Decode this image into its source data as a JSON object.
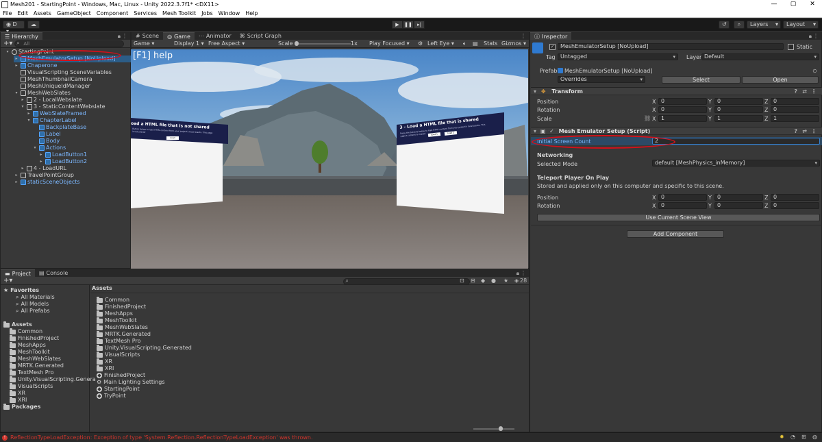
{
  "window": {
    "title": "Mesh201 - StartingPoint - Windows, Mac, Linux - Unity 2022.3.7f1* <DX11>",
    "controls": [
      "—",
      "▢",
      "✕"
    ]
  },
  "menu": [
    "File",
    "Edit",
    "Assets",
    "GameObject",
    "Component",
    "Services",
    "Mesh Toolkit",
    "Jobs",
    "Window",
    "Help"
  ],
  "toolbar": {
    "account": "D",
    "layers": "Layers",
    "layout": "Layout"
  },
  "hierarchy": {
    "tab": "Hierarchy",
    "search_placeholder": "All",
    "items": [
      {
        "label": "StartingPoint",
        "indent": 0,
        "fold": "▾",
        "type": "scene"
      },
      {
        "label": "MeshEmulatorSetup [NoUpload]",
        "indent": 1,
        "fold": "▸",
        "type": "prefab"
      },
      {
        "label": "Chaperone",
        "indent": 1,
        "fold": "▸",
        "type": "prefab"
      },
      {
        "label": "VisualScripting SceneVariables",
        "indent": 1,
        "fold": "",
        "type": "object"
      },
      {
        "label": "MeshThumbnailCamera",
        "indent": 1,
        "fold": "",
        "type": "object"
      },
      {
        "label": "MeshUniqueIdManager",
        "indent": 1,
        "fold": "",
        "type": "object"
      },
      {
        "label": "MeshWebSlates",
        "indent": 1,
        "fold": "▾",
        "type": "object"
      },
      {
        "label": "2 - LocalWebslate",
        "indent": 2,
        "fold": "▸",
        "type": "object"
      },
      {
        "label": "3 - StaticContentWebslate",
        "indent": 2,
        "fold": "▾",
        "type": "object"
      },
      {
        "label": "WebSlateFramed",
        "indent": 3,
        "fold": "▸",
        "type": "prefab"
      },
      {
        "label": "ChapterLabel",
        "indent": 3,
        "fold": "▾",
        "type": "prefab"
      },
      {
        "label": "BackplateBase",
        "indent": 4,
        "fold": "",
        "type": "prefab"
      },
      {
        "label": "Label",
        "indent": 4,
        "fold": "",
        "type": "prefab"
      },
      {
        "label": "Body",
        "indent": 4,
        "fold": "",
        "type": "prefab"
      },
      {
        "label": "Actions",
        "indent": 4,
        "fold": "▾",
        "type": "prefab"
      },
      {
        "label": "LoadButton1",
        "indent": 5,
        "fold": "▸",
        "type": "prefab"
      },
      {
        "label": "LoadButton2",
        "indent": 5,
        "fold": "▸",
        "type": "prefab"
      },
      {
        "label": "4 - LoadURL",
        "indent": 2,
        "fold": "▸",
        "type": "object"
      },
      {
        "label": "TravelPointGroup",
        "indent": 1,
        "fold": "▸",
        "type": "object"
      },
      {
        "label": "staticSceneObjects",
        "indent": 1,
        "fold": "▸",
        "type": "prefab"
      }
    ]
  },
  "scene_tabs": [
    "Scene",
    "Game",
    "Animator",
    "Script Graph"
  ],
  "game_bar": {
    "mode": "Game",
    "display": "Display 1",
    "aspect": "Free Aspect",
    "scale_label": "Scale",
    "scale_value": "1x",
    "play_focused": "Play Focused",
    "eye": "Left Eye",
    "stats": "Stats",
    "gizmos": "Gizmos"
  },
  "game": {
    "help": "[F1] help",
    "left_slate_title": "oad a HTML file that is not shared",
    "left_slate_body": "Button below to load HTML content from your project's local assets. This page is not shared",
    "left_slate_button": "Load",
    "right_slate_title": "3 - Load a HTML file that is shared",
    "right_slate_body": "Press the buttons below to load HTML content from your project's local assets. This page's content is shared",
    "right_slate_buttons": [
      "Load 1",
      "Load 2"
    ]
  },
  "inspector": {
    "tab": "Inspector",
    "object_name": "MeshEmulatorSetup [NoUpload]",
    "static_label": "Static",
    "tag_label": "Tag",
    "tag_value": "Untagged",
    "layer_label": "Layer",
    "layer_value": "Default",
    "prefab_label": "Prefab",
    "prefab_value": "MeshEmulatorSetup [NoUpload]",
    "overrides": "Overrides",
    "select": "Select",
    "open": "Open",
    "transform": {
      "title": "Transform",
      "position_label": "Position",
      "rotation_label": "Rotation",
      "scale_label": "Scale",
      "position": [
        "0",
        "0",
        "0"
      ],
      "rotation": [
        "0",
        "0",
        "0"
      ],
      "scale": [
        "1",
        "1",
        "1"
      ]
    },
    "script": {
      "title": "Mesh Emulator Setup (Script)",
      "initial_screen_count_label": "Initial Screen Count",
      "initial_screen_count": "2",
      "networking_label": "Networking",
      "selected_mode_label": "Selected Mode",
      "selected_mode": "default [MeshPhysics_inMemory]",
      "teleport_label": "Teleport Player On Play",
      "teleport_desc": "Stored and applied only on this computer and specific to this scene.",
      "position_label": "Position",
      "rotation_label": "Rotation",
      "position": [
        "0",
        "0",
        "0"
      ],
      "rotation": [
        "0",
        "0",
        "0"
      ],
      "use_scene_view": "Use Current Scene View"
    },
    "add_component": "Add Component",
    "axis": [
      "X",
      "Y",
      "Z"
    ]
  },
  "project": {
    "tabs": [
      "Project",
      "Console"
    ],
    "count": "28",
    "favorites_label": "Favorites",
    "favorites": [
      "All Materials",
      "All Models",
      "All Prefabs"
    ],
    "assets_label": "Assets",
    "tree": [
      "Common",
      "FinishedProject",
      "MeshApps",
      "MeshToolkit",
      "MeshWebSlates",
      "MRTK.Generated",
      "TextMesh Pro",
      "Unity.VisualScripting.Genera",
      "VisualScripts",
      "XR",
      "XRI"
    ],
    "packages_label": "Packages",
    "breadcrumb": "Assets",
    "folders": [
      "Common",
      "FinishedProject",
      "MeshApps",
      "MeshToolkit",
      "MeshWebSlates",
      "MRTK.Generated",
      "TextMesh Pro",
      "Unity.VisualScripting.Generated",
      "VisualScripts",
      "XR",
      "XRI"
    ],
    "scenes": [
      "FinishedProject",
      "Main Lighting Settings",
      "StartingPoint",
      "TryPoint"
    ]
  },
  "status": {
    "error": "ReflectionTypeLoadException: Exception of type 'System.Reflection.ReflectionTypeLoadException' was thrown."
  }
}
